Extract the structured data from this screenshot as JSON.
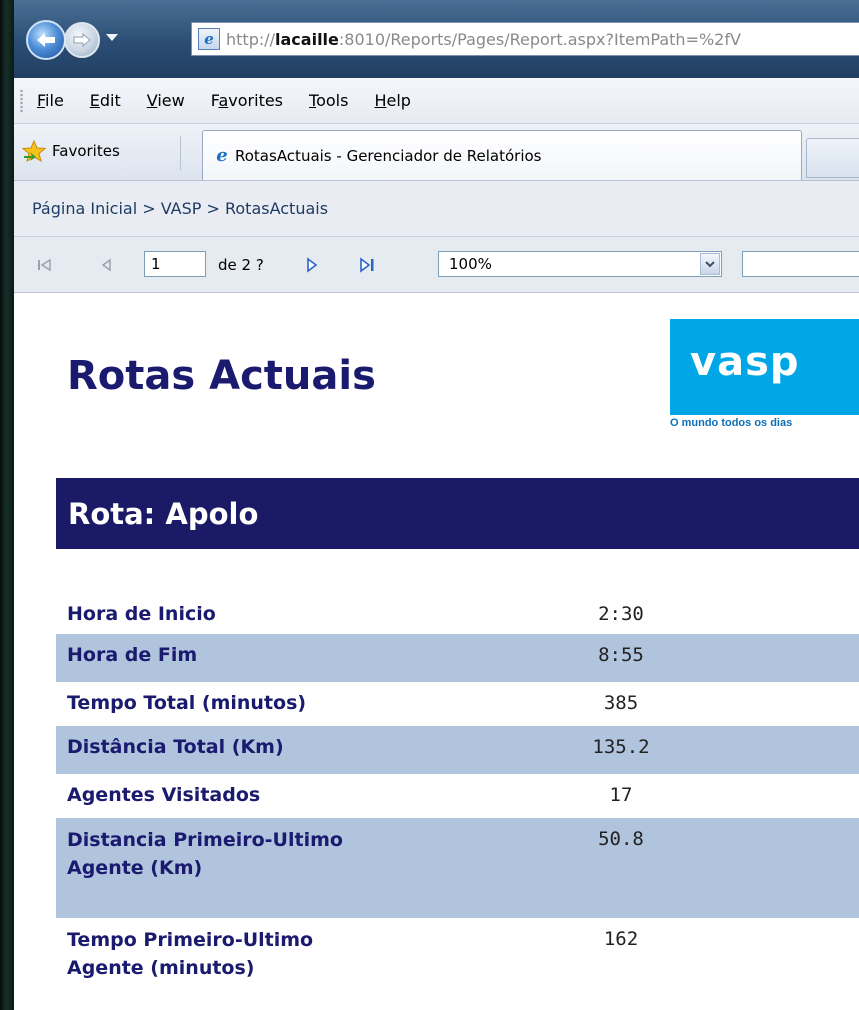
{
  "browser": {
    "url_prefix": "http://",
    "url_host": "lacaille",
    "url_rest": ":8010/Reports/Pages/Report.aspx?ItemPath=%2fV",
    "menu": [
      "File",
      "Edit",
      "View",
      "Favorites",
      "Tools",
      "Help"
    ],
    "menu_access_keys": [
      "F",
      "E",
      "V",
      "a",
      "T",
      "H"
    ],
    "favorites_label": "Favorites",
    "tab_title": "RotasActuais - Gerenciador de Relatórios"
  },
  "breadcrumb": "Página Inicial > VASP > RotasActuais",
  "toolbar": {
    "page_value": "1",
    "page_of": "de 2 ?",
    "zoom_value": "100%"
  },
  "report": {
    "title": "Rotas Actuais",
    "logo_text": "vasp",
    "logo_tagline": "O mundo todos os dias",
    "route_label": "Rota: Apolo",
    "rows": [
      {
        "label": "Hora de Inicio",
        "value": "2:30"
      },
      {
        "label": "Hora de Fim",
        "value": "8:55"
      },
      {
        "label": "Tempo Total (minutos)",
        "value": "385"
      },
      {
        "label": "Distância Total (Km)",
        "value": "135.2"
      },
      {
        "label": "Agentes Visitados",
        "value": "17"
      },
      {
        "label": "Distancia Primeiro-Ultimo Agente (Km)",
        "value": "50.8"
      },
      {
        "label": "Tempo Primeiro-Ultimo Agente (minutos)",
        "value": "162"
      }
    ]
  },
  "colors": {
    "title_navy": "#1a1a6e",
    "band_navy": "#1a1a66",
    "row_alt": "#b0c4de",
    "logo_blue": "#00a6e6"
  }
}
